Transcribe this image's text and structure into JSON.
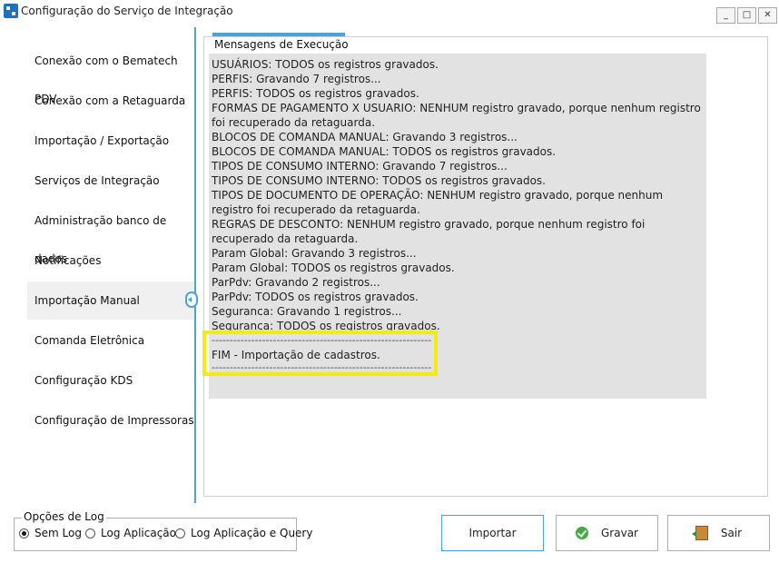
{
  "window": {
    "title": "Configuração do Serviço de Integração",
    "min_label": "_",
    "max_label": "□",
    "close_label": "✕"
  },
  "sidebar": {
    "items": [
      {
        "label": "Conexão com o Bematech PDV"
      },
      {
        "label": "Conexão com a Retaguarda"
      },
      {
        "label": "Importação / Exportação"
      },
      {
        "label": "Serviços de Integração"
      },
      {
        "label": "Administração banco de dados"
      },
      {
        "label": "Notificações"
      },
      {
        "label": "Importação Manual"
      },
      {
        "label": "Comanda Eletrônica"
      },
      {
        "label": "Configuração KDS"
      },
      {
        "label": "Configuração de Impressoras"
      }
    ],
    "active_index": 6
  },
  "panel": {
    "title": "Mensagens de Execução",
    "log_lines": [
      "USUÁRIOS: TODOS os registros gravados.",
      "PERFIS: Gravando 7 registros...",
      "PERFIS: TODOS os registros gravados.",
      "FORMAS DE PAGAMENTO X USUARIO: NENHUM registro gravado, porque nenhum registro foi recuperado da retaguarda.",
      "BLOCOS DE COMANDA MANUAL: Gravando 3 registros...",
      "BLOCOS DE COMANDA MANUAL: TODOS os registros gravados.",
      "TIPOS DE CONSUMO INTERNO: Gravando 7 registros...",
      "TIPOS DE CONSUMO INTERNO: TODOS os registros gravados.",
      "TIPOS DE DOCUMENTO DE OPERAÇÃO: NENHUM registro gravado, porque nenhum registro foi recuperado da retaguarda.",
      "REGRAS DE DESCONTO: NENHUM registro gravado, porque nenhum registro foi recuperado da retaguarda.",
      "Param Global: Gravando 3 registros...",
      "Param Global: TODOS os registros gravados.",
      "ParPdv: Gravando 2 registros...",
      "ParPdv: TODOS os registros gravados.",
      "Seguranca: Gravando 1 registros...",
      "Seguranca: TODOS os registros gravados."
    ],
    "separator": "--------------------------------------------------------------------------------------",
    "final_message": "FIM - Importação de cadastros."
  },
  "log_options": {
    "title": "Opções de Log",
    "options": [
      {
        "label": "Sem Log",
        "selected": true
      },
      {
        "label": "Log Aplicação",
        "selected": false
      },
      {
        "label": "Log Aplicação e Query",
        "selected": false
      }
    ]
  },
  "buttons": {
    "import_label": "Importar",
    "save_label": "Gravar",
    "exit_label": "Sair"
  },
  "colors": {
    "accent": "#4aa3d8",
    "highlight": "#f4ea14",
    "log_background": "#e2e2e2"
  }
}
